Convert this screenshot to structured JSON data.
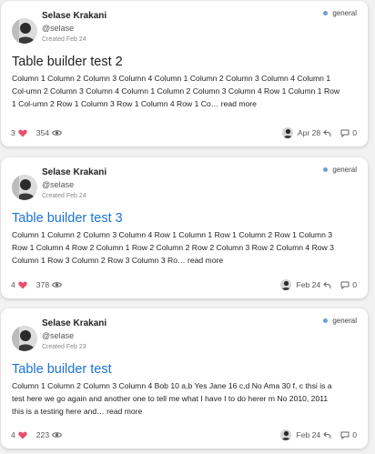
{
  "colors": {
    "accent": "#1a73d9",
    "heart": "#e8506b",
    "category_dot": "#6b9fd4"
  },
  "posts": [
    {
      "author": {
        "name": "Selase Krakani",
        "handle": "@selase",
        "created": "Created Feb 24"
      },
      "category": "general",
      "title": "Table builder test 2",
      "title_style": "plain",
      "excerpt": "Column 1 Column 2 Column 3 Column 4 Column 1 Column 2 Column 3 Column 4 Column 1 Col-umn 2 Column 3 Column 4 Column 1 Column 2 Column 3 Column 4 Row 1 Column 1 Row 1 Col-umn 2 Row 1 Column 3 Row 1 Column 4 Row 1 Co…",
      "read_more": "read more",
      "likes": "3",
      "views": "354",
      "date": "Apr 28",
      "replies": "0"
    },
    {
      "author": {
        "name": "Selase Krakani",
        "handle": "@selase",
        "created": "Created Feb 24"
      },
      "category": "general",
      "title": "Table builder test 3",
      "title_style": "link",
      "excerpt": "Column 1 Column 2 Column 3 Column 4 Row 1 Column 1 Row 1 Column 2 Row 1 Column 3 Row 1 Column 4 Row 2 Column 1 Row 2 Column 2 Row 2 Column 3 Row 2 Column 4 Row 3 Column 1 Row 3 Column 2 Row 3 Column 3 Ro…",
      "read_more": "read more",
      "likes": "4",
      "views": "378",
      "date": "Feb 24",
      "replies": "0"
    },
    {
      "author": {
        "name": "Selase Krakani",
        "handle": "@selase",
        "created": "Created Feb 23"
      },
      "category": "general",
      "title": "Table builder test",
      "title_style": "link",
      "excerpt": "Column 1 Column 2 Column 3 Column 4 Bob 10 a,b Yes Jane 16 c,d No Ama 30 f, c thsi is a test here we go again and another one to tell me what I have I to do herer m No 2010, 2011 this is a testing here and…",
      "read_more": "read more",
      "likes": "4",
      "views": "223",
      "date": "Feb 24",
      "replies": "0"
    }
  ]
}
